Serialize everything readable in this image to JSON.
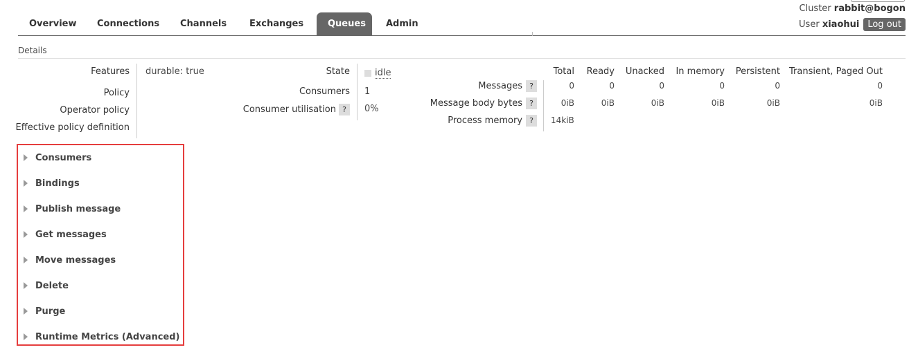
{
  "header": {
    "cluster_label": "Cluster",
    "cluster_name": "rabbit@bogon",
    "user_label": "User",
    "user_name": "xiaohui",
    "logout_label": "Log out"
  },
  "tabs": [
    {
      "label": "Overview"
    },
    {
      "label": "Connections"
    },
    {
      "label": "Channels"
    },
    {
      "label": "Exchanges"
    },
    {
      "label": "Queues",
      "active": true
    },
    {
      "label": "Admin"
    }
  ],
  "details": {
    "title": "Details",
    "features_label": "Features",
    "features_key": "durable:",
    "features_value": "true",
    "policy_label": "Policy",
    "operator_policy_label": "Operator policy",
    "effective_policy_label": "Effective policy definition",
    "state_label": "State",
    "state_value": "idle",
    "consumers_label": "Consumers",
    "consumers_value": "1",
    "consumer_util_label": "Consumer utilisation",
    "consumer_util_value": "0%",
    "help_glyph": "?"
  },
  "stats": {
    "columns": [
      "Total",
      "Ready",
      "Unacked",
      "In memory",
      "Persistent",
      "Transient, Paged Out"
    ],
    "rows": [
      {
        "label": "Messages",
        "values": [
          "0",
          "0",
          "0",
          "0",
          "0",
          "0"
        ]
      },
      {
        "label": "Message body bytes",
        "values": [
          "0iB",
          "0iB",
          "0iB",
          "0iB",
          "0iB",
          "0iB"
        ]
      },
      {
        "label": "Process memory",
        "values": [
          "14kiB"
        ]
      }
    ]
  },
  "sections": [
    {
      "label": "Consumers"
    },
    {
      "label": "Bindings"
    },
    {
      "label": "Publish message"
    },
    {
      "label": "Get messages"
    },
    {
      "label": "Move messages"
    },
    {
      "label": "Delete"
    },
    {
      "label": "Purge"
    },
    {
      "label": "Runtime Metrics (Advanced)"
    }
  ],
  "colors": {
    "active_tab": "#666666",
    "highlight_border": "#e53d3d"
  }
}
